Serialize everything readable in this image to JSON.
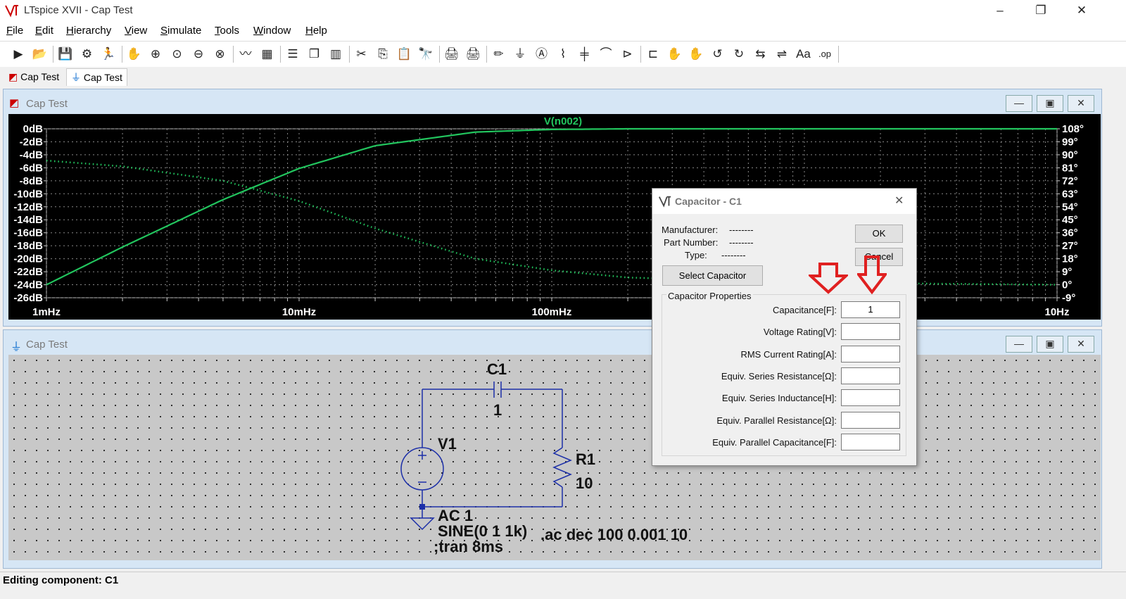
{
  "window": {
    "title": "LTspice XVII - Cap Test",
    "minimize": "–",
    "restore": "❐",
    "close": "✕"
  },
  "menu": [
    {
      "key": "F",
      "rest": "ile"
    },
    {
      "key": "E",
      "rest": "dit"
    },
    {
      "key": "H",
      "rest": "ierarchy"
    },
    {
      "key": "V",
      "rest": "iew"
    },
    {
      "key": "S",
      "rest": "imulate"
    },
    {
      "key": "T",
      "rest": "ools"
    },
    {
      "key": "W",
      "rest": "indow"
    },
    {
      "key": "H",
      "rest": "elp"
    }
  ],
  "toolbar": {
    "icons": [
      "run-icon",
      "open-icon",
      "save-icon",
      "control-panel-icon",
      "halt-icon",
      "pan-icon",
      "zoom-in-icon",
      "zoom-area-icon",
      "zoom-out-icon",
      "zoom-fit-icon",
      "autorange-icon",
      "grid-icon",
      "tile-horizontal-icon",
      "cascade-icon",
      "tile-vertical-icon",
      "cut-icon",
      "copy-icon",
      "paste-icon",
      "find-icon",
      "print-setup-icon",
      "print-icon",
      "wire-icon",
      "ground-icon",
      "label-icon",
      "resistor-icon",
      "capacitor-icon",
      "inductor-icon",
      "diode-icon",
      "component-icon",
      "move-icon",
      "drag-icon",
      "undo-icon",
      "redo-icon",
      "rotate-icon",
      "mirror-icon",
      "text-icon",
      "spice-directive-icon"
    ],
    "glyphs": [
      "▶",
      "📂",
      "💾",
      "⚙",
      "🏃",
      "✋",
      "⊕",
      "⊙",
      "⊖",
      "⊗",
      "〰",
      "▦",
      "☰",
      "❐",
      "▥",
      "✂",
      "⎘",
      "📋",
      "🔭",
      "🖨",
      "🖨",
      "✏",
      "⏚",
      "Ⓐ",
      "⌇",
      "╪",
      "⌒",
      "⊳",
      "⊏",
      "✋",
      "✋",
      "↺",
      "↻",
      "⇆",
      "⇌",
      "Aa",
      ".op"
    ]
  },
  "tabs": [
    {
      "label": "Cap Test",
      "icon": "waveform-icon"
    },
    {
      "label": "Cap Test",
      "icon": "schematic-icon"
    }
  ],
  "plot_window": {
    "title": "Cap Test"
  },
  "schematic_window": {
    "title": "Cap Test"
  },
  "chart_data": {
    "type": "line",
    "title": "V(n002)",
    "x_axis": {
      "scale": "log",
      "ticks": [
        "1mHz",
        "10mHz",
        "100mHz",
        "10Hz"
      ],
      "range_hz": [
        0.001,
        10
      ]
    },
    "y_left": {
      "label_unit": "dB",
      "ticks": [
        "0dB",
        "-2dB",
        "-4dB",
        "-6dB",
        "-8dB",
        "-10dB",
        "-12dB",
        "-14dB",
        "-16dB",
        "-18dB",
        "-20dB",
        "-22dB",
        "-24dB",
        "-26dB"
      ],
      "range": [
        -26,
        0
      ]
    },
    "y_right": {
      "label_unit": "deg",
      "ticks": [
        "108°",
        "99°",
        "90°",
        "81°",
        "72°",
        "63°",
        "54°",
        "45°",
        "36°",
        "27°",
        "18°",
        "9°",
        "0°",
        "-9°"
      ],
      "range": [
        -9,
        108
      ]
    },
    "grid": true,
    "color": "#22c55e",
    "series": [
      {
        "name": "magnitude",
        "style": "solid",
        "points": [
          [
            0.001,
            -24
          ],
          [
            0.002,
            -18.2
          ],
          [
            0.005,
            -10.9
          ],
          [
            0.01,
            -6.1
          ],
          [
            0.02,
            -2.6
          ],
          [
            0.05,
            -0.5
          ],
          [
            0.1,
            -0.1
          ],
          [
            0.2,
            0
          ],
          [
            1,
            0
          ],
          [
            10,
            0
          ]
        ]
      },
      {
        "name": "phase",
        "style": "dotted",
        "points": [
          [
            0.001,
            86
          ],
          [
            0.002,
            82
          ],
          [
            0.005,
            72
          ],
          [
            0.01,
            58
          ],
          [
            0.02,
            39
          ],
          [
            0.05,
            18
          ],
          [
            0.1,
            10
          ],
          [
            0.2,
            5
          ],
          [
            1,
            1.5
          ],
          [
            10,
            0
          ]
        ]
      }
    ]
  },
  "schematic": {
    "c1_name": "C1",
    "c1_value": "1",
    "v1_name": "V1",
    "r1_name": "R1",
    "r1_value": "10",
    "v1_ac": "AC 1",
    "v1_sine": "SINE(0 1 1k)",
    "tran_directive": ";tran 8ms",
    "ac_directive": ".ac dec 100 0.001 10"
  },
  "dialog": {
    "title": "Capacitor - C1",
    "close": "✕",
    "manufacturer_label": "Manufacturer:",
    "manufacturer_value": "--------",
    "part_label": "Part Number:",
    "part_value": "--------",
    "type_label": "Type:",
    "type_value": "--------",
    "ok": "OK",
    "cancel": "Cancel",
    "select_button": "Select Capacitor",
    "group_label": "Capacitor Properties",
    "fields": [
      {
        "label": "Capacitance[F]:",
        "value": "1"
      },
      {
        "label": "Voltage Rating[V]:",
        "value": ""
      },
      {
        "label": "RMS Current Rating[A]:",
        "value": ""
      },
      {
        "label": "Equiv. Series Resistance[Ω]:",
        "value": ""
      },
      {
        "label": "Equiv. Series Inductance[H]:",
        "value": ""
      },
      {
        "label": "Equiv. Parallel Resistance[Ω]:",
        "value": ""
      },
      {
        "label": "Equiv. Parallel Capacitance[F]:",
        "value": ""
      }
    ],
    "annotation_color": "#e02020"
  },
  "status": {
    "text": "Editing component: C1"
  }
}
